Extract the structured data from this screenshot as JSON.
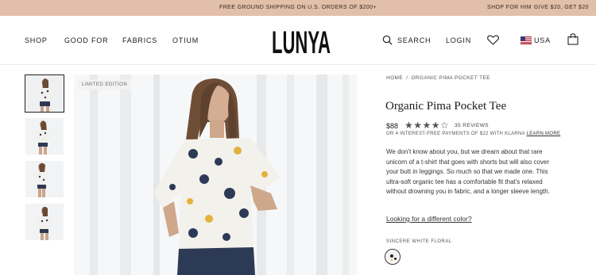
{
  "promo": {
    "center": "FREE GROUND SHIPPING ON U.S. ORDERS OF $200+",
    "shop_for_him": "SHOP FOR HIM",
    "give_get": "GIVE $20, GET $20"
  },
  "header": {
    "logo_text": "LUNYA",
    "nav": [
      "SHOP",
      "GOOD FOR",
      "FABRICS",
      "OTIUM"
    ],
    "search_label": "SEARCH",
    "login_label": "LOGIN",
    "country_label": "USA",
    "icons": [
      "search-icon",
      "heart-icon",
      "us-flag-icon",
      "shopping-bag-icon"
    ]
  },
  "gallery": {
    "badge": "LIMITED EDITION",
    "thumbnails": 4
  },
  "product": {
    "breadcrumb": [
      "HOME",
      "/",
      "ORGANIC PIMA POCKET TEE"
    ],
    "title": "Organic Pima Pocket Tee",
    "price": "$88",
    "rating": 4.5,
    "stars": "★★★★☆",
    "reviews": "35 REVIEWS",
    "klarna_text": "OR 4 INTEREST-FREE PAYMENTS OF $22 WITH KLARNA",
    "klarna_link": "LEARN MORE",
    "description": "We don't know about you, but we dream about that rare unicorn of a t-shirt that goes with shorts but will also cover your butt in leggings. So much so that we made one. This ultra-soft organic tee has a comfortable fit that's relaxed without drowning you in fabric, and a longer sleeve length.",
    "color_link": "Looking for a different color?",
    "color_name": "SINCERE WHITE FLORAL"
  },
  "colors": {
    "promo_bg": "#e2bfa8",
    "text": "#1e1e1e",
    "muted": "#555555"
  }
}
